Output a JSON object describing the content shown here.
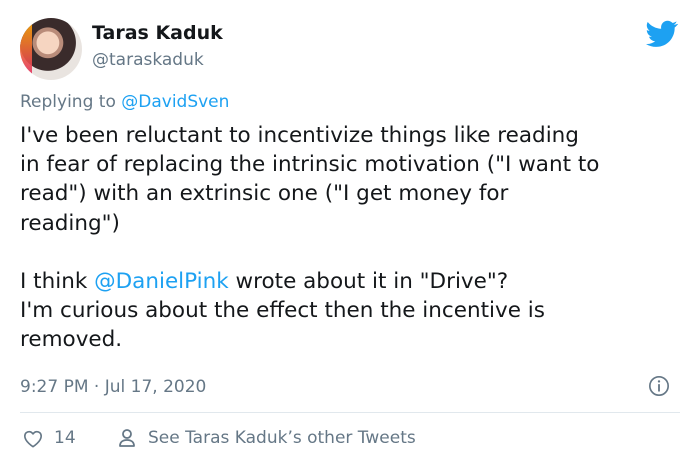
{
  "author": {
    "name": "Taras Kaduk",
    "handle": "@taraskaduk"
  },
  "reply": {
    "prefix": "Replying to ",
    "mention": "@DavidSven"
  },
  "tweet": {
    "line1": "I've been reluctant to incentivize things like reading",
    "line2": "in fear of replacing the intrinsic motivation (\"I want to",
    "line3": "read\") with an extrinsic one (\"I get money for",
    "line4": "reading\")",
    "p2_prefix": "I think ",
    "p2_mention": "@DanielPink",
    "p2_suffix": " wrote about it in \"Drive\"?",
    "line6": "I'm curious about the effect then the incentive is",
    "line7": "removed."
  },
  "timestamp": "9:27 PM · Jul 17, 2020",
  "actions": {
    "like_count": "14",
    "profile_link": "See Taras Kaduk’s other Tweets"
  },
  "icons": {
    "brand": "twitter-bird-icon",
    "info": "info-icon",
    "like": "heart-icon",
    "profile": "person-icon"
  },
  "colors": {
    "accent": "#1da1f2",
    "secondary_text": "#657786",
    "primary_text": "#14171a",
    "divider": "#e1e8ed"
  }
}
